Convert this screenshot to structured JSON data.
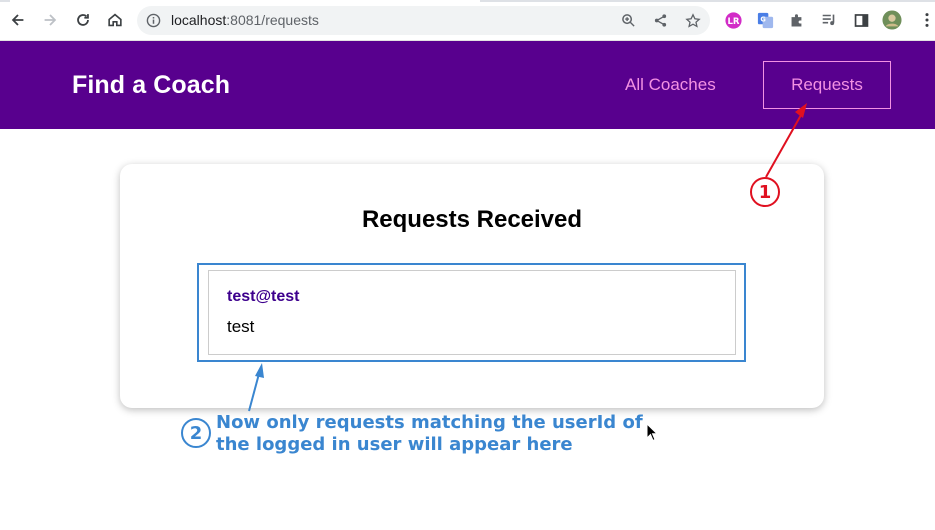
{
  "browser": {
    "url_host": "localhost",
    "url_rest": ":8081/requests",
    "icons": [
      "back-icon",
      "forward-icon",
      "reload-icon",
      "home-icon",
      "info-icon",
      "zoom-icon",
      "share-icon",
      "star-icon",
      "extension-icon",
      "puzzle-icon",
      "media-icon",
      "sidebar-icon",
      "profile-avatar",
      "menu-icon"
    ],
    "ext_lr": "LR"
  },
  "header": {
    "title": "Find a Coach",
    "nav": {
      "all_coaches": "All Coaches",
      "requests": "Requests"
    },
    "colors": {
      "background": "#58008e",
      "link": "#f391e3"
    }
  },
  "main": {
    "title": "Requests Received",
    "requests": [
      {
        "email": "test@test",
        "message": "test"
      }
    ]
  },
  "annotations": {
    "badge1": "1",
    "badge2": "2",
    "note_line1": "Now only requests matching the userId of",
    "note_line2": "the logged in user will appear here",
    "colors": {
      "red": "#e01020",
      "blue": "#3a86d0"
    }
  }
}
